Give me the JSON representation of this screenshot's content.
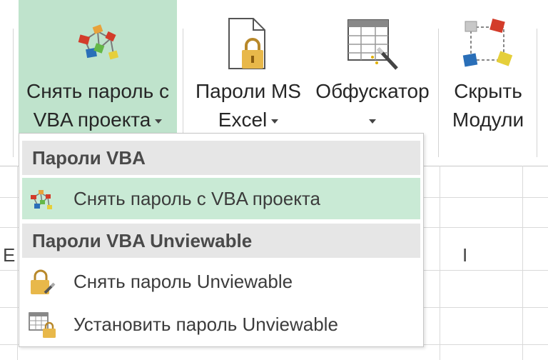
{
  "ribbon": {
    "vba_button": {
      "line1": "Снять пароль с",
      "line2": "VBA проекта"
    },
    "ms_button": {
      "line1": "Пароли MS",
      "line2": "Excel"
    },
    "obf_button": {
      "line1": "Обфускатор"
    },
    "hide_button": {
      "line1": "Скрыть",
      "line2": "Модули"
    }
  },
  "grid": {
    "col_e": "E",
    "col_i": "I"
  },
  "menu": {
    "header1": "Пароли VBA",
    "item1": "Снять пароль с VBA проекта",
    "header2": "Пароли VBA Unviewable",
    "item2": "Снять пароль Unviewable",
    "item3": "Установить пароль Unviewable"
  },
  "colors": {
    "accent": "#bfe3cc",
    "highlight": "#c9ead5",
    "header_bg": "#e6e6e6"
  }
}
